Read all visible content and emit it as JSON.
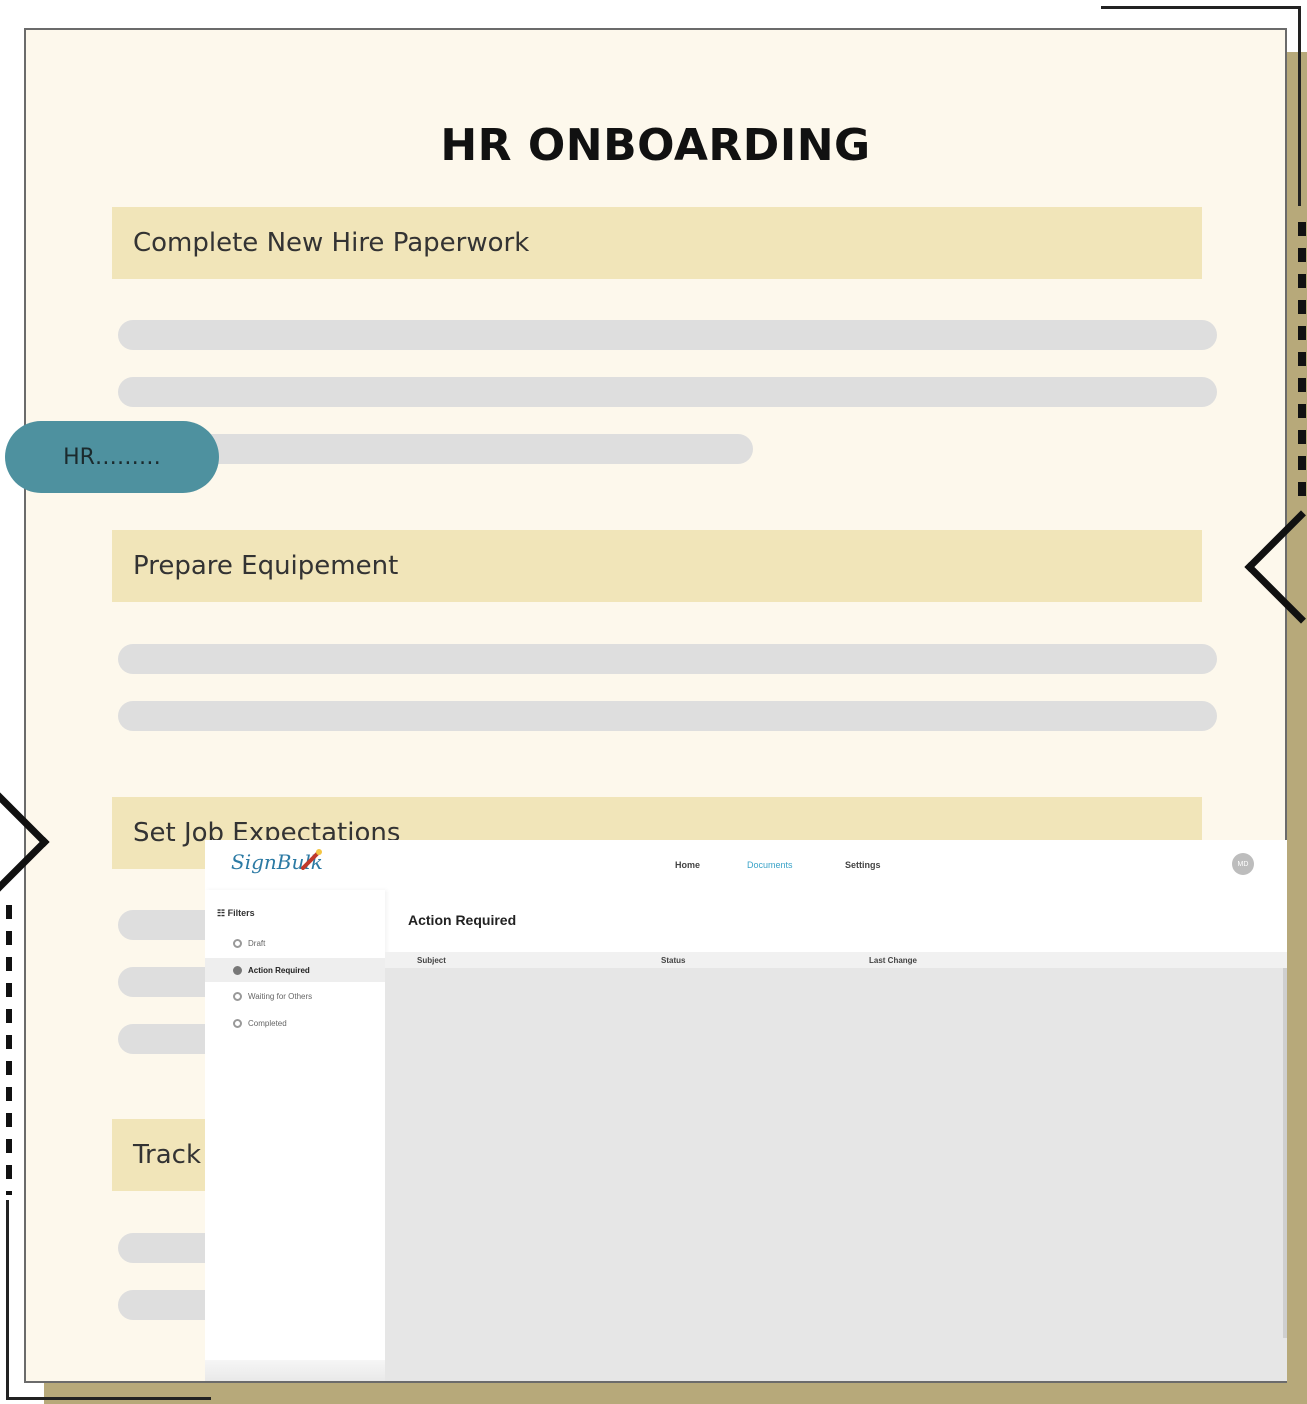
{
  "document": {
    "title": "HR ONBOARDING",
    "sections": [
      "Complete New Hire Paperwork",
      "Prepare Equipement",
      "Set Job Expectations",
      "Track I"
    ],
    "hr_pill_label": "HR………"
  },
  "app": {
    "logo_text": "SignBulk",
    "nav": [
      "Home",
      "Documents",
      "Settings"
    ],
    "active_nav": "Documents",
    "avatar_initials": "MD",
    "filters_label": "Filters",
    "filters": [
      "Draft",
      "Action Required",
      "Waiting for Others",
      "Completed"
    ],
    "selected_filter": "Action Required",
    "page_title": "Action Required",
    "table_columns": [
      "Subject",
      "Status",
      "Last Change"
    ]
  },
  "colors": {
    "paper": "#fdf8ec",
    "section_header": "#f1e5b9",
    "frame_shadow": "#b7a97a",
    "pill": "#4e919f",
    "accent_nav": "#3aa3c8"
  }
}
